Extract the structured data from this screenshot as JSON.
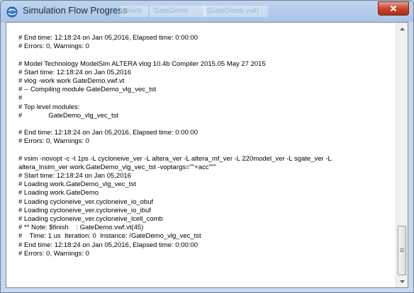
{
  "window": {
    "title": "Simulation Flow Progress",
    "background_tabs": [
      "Shirts",
      "GateDemo",
      "(GateDemo.vwf)"
    ]
  },
  "log_lines": [
    "# End time: 12:18:24 on Jan 05,2016, Elapsed time: 0:00:00",
    "# Errors: 0, Warnings: 0",
    "",
    "# Model Technology ModelSim ALTERA vlog 10.4b Compiler 2015.05 May 27 2015",
    "# Start time: 12:18:24 on Jan 05,2016",
    "# vlog -work work GateDemo.vwf.vt",
    "# -- Compiling module GateDemo_vlg_vec_tst",
    "#",
    "# Top level modules:",
    "#              GateDemo_vlg_vec_tst",
    "",
    "# End time: 12:18:24 on Jan 05,2016, Elapsed time: 0:00:00",
    "# Errors: 0, Warnings: 0",
    "",
    "# vsim -novopt -c -t 1ps -L cycloneive_ver -L altera_ver -L altera_mf_ver -L 220model_ver -L sgate_ver -L",
    "altera_lnsim_ver work.GateDemo_vlg_vec_tst -voptargs=\"\"+acc\"\"\"",
    "# Start time: 12:18:24 on Jan 05,2016",
    "# Loading work.GateDemo_vlg_vec_tst",
    "# Loading work.GateDemo",
    "# Loading cycloneive_ver.cycloneive_io_obuf",
    "# Loading cycloneive_ver.cycloneive_io_ibuf",
    "# Loading cycloneive_ver.cycloneive_lcell_comb",
    "# ** Note: $finish    : GateDemo.vwf.vt(45)",
    "#    Time: 1 us  Iteration: 0  Instance: /GateDemo_vlg_vec_tst",
    "# End time: 12:18:24 on Jan 05,2016, Elapsed time: 0:00:00",
    "# Errors: 0, Warnings: 0"
  ],
  "icons": {
    "app": "simulation-globe-icon",
    "close": "close-icon",
    "scroll_up": "scroll-up-arrow-icon",
    "scroll_down": "scroll-down-arrow-icon"
  },
  "colors": {
    "close_button": "#c7452e",
    "title_bar": "#b3cbea",
    "log_background": "#ffffff",
    "log_text": "#000000"
  },
  "scroll_position": 0.92
}
